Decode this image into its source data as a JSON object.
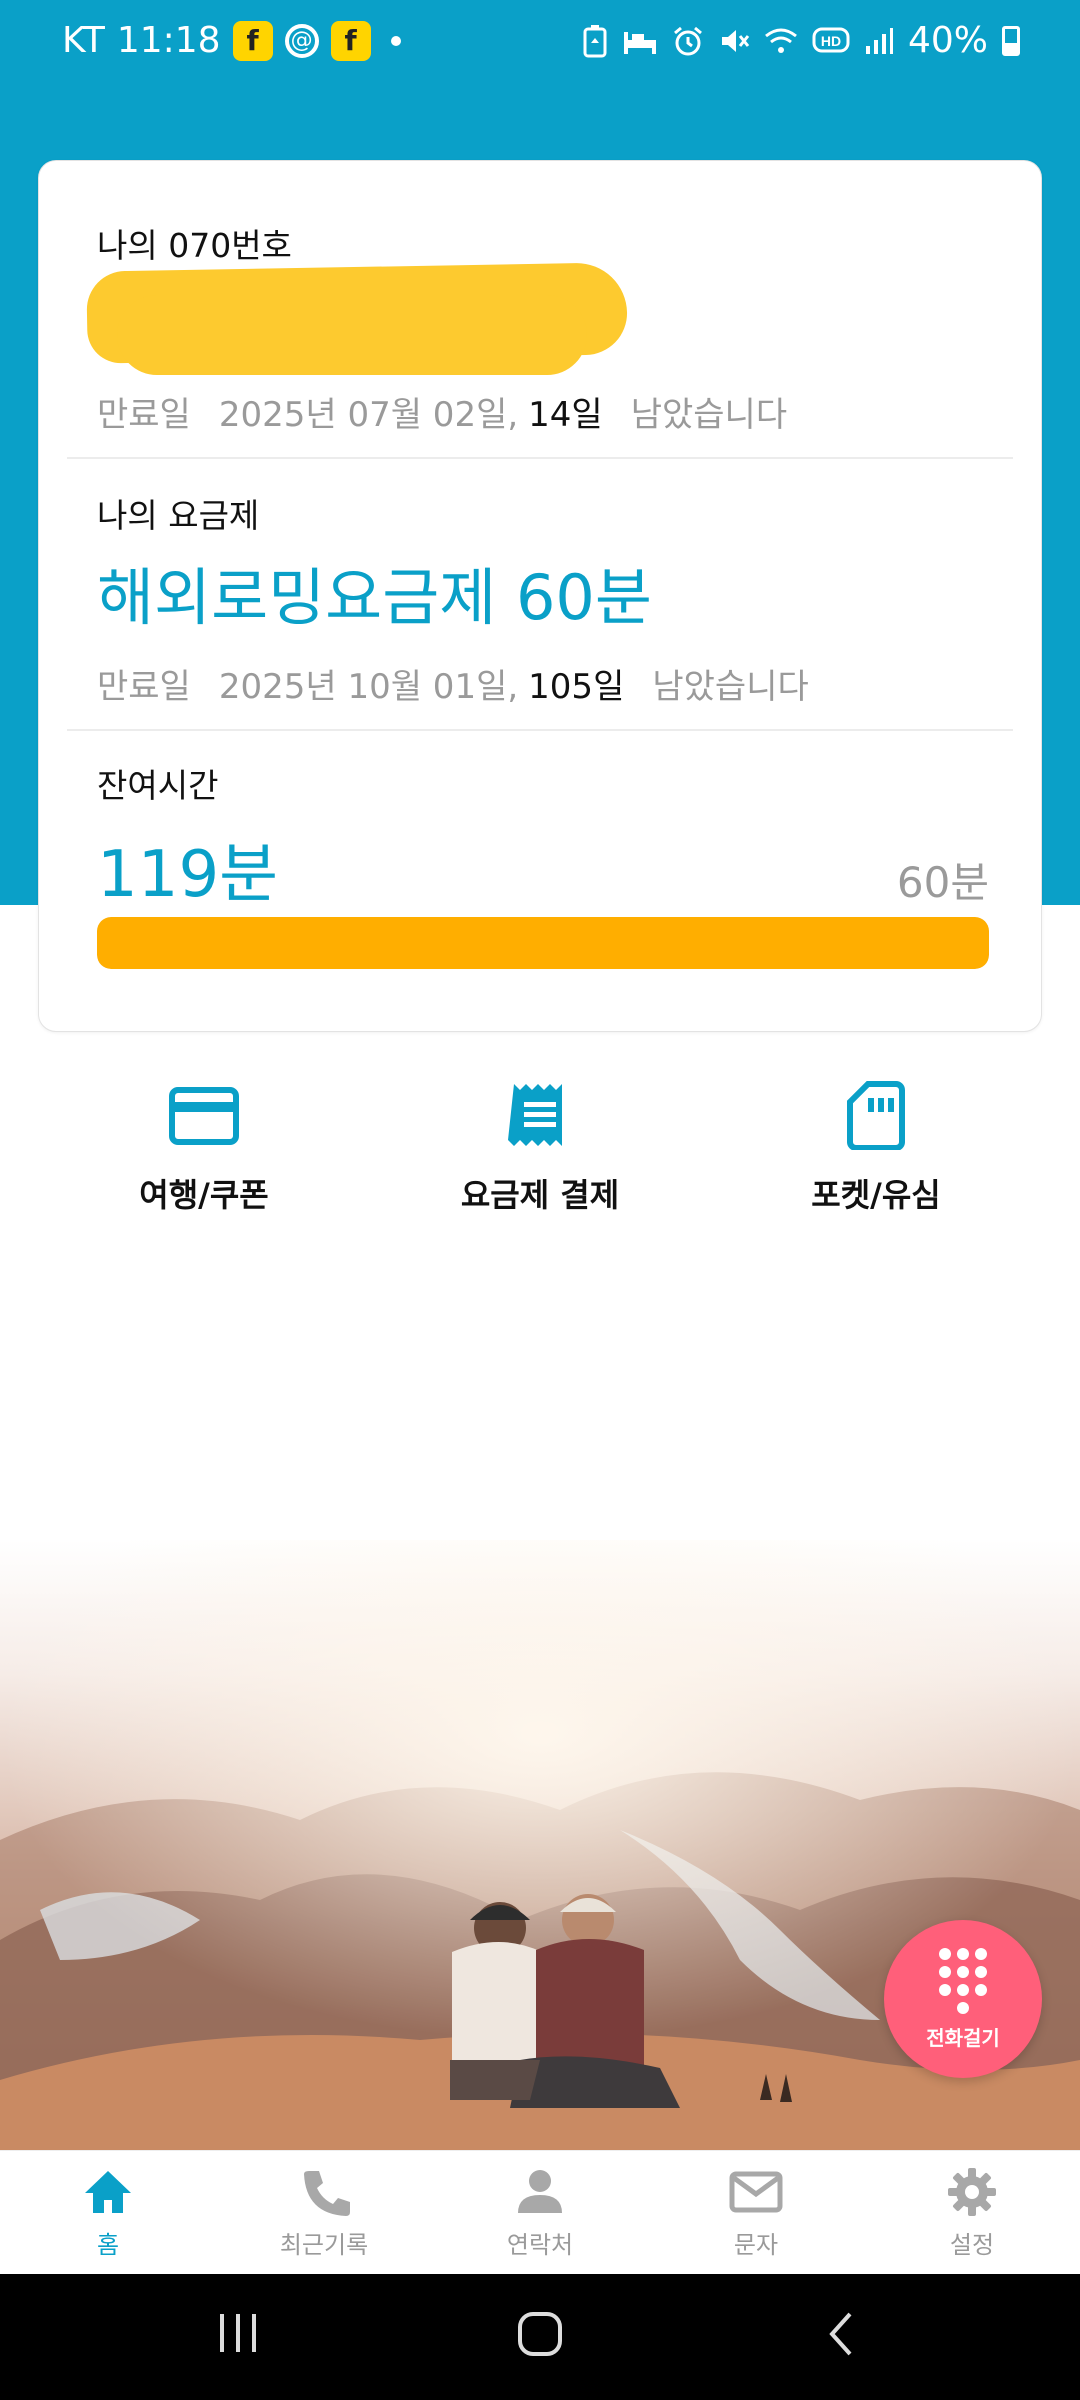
{
  "status_bar": {
    "carrier": "KT",
    "time": "11:18",
    "notif_badge_1": "f",
    "notif_threads": "@",
    "notif_badge_2": "f",
    "battery": "40%",
    "icons": [
      "battery-saver-icon",
      "sleep-icon",
      "alarm-icon",
      "mute-icon",
      "wifi-icon",
      "hd-icon",
      "signal-icon"
    ]
  },
  "card": {
    "number_section": {
      "label": "나의 070번호",
      "expire_label": "만료일",
      "expire_date": "2025년 07월 02일,",
      "days_left": "14일",
      "suffix": "남았습니다"
    },
    "plan_section": {
      "label": "나의 요금제",
      "plan_name": "해외로밍요금제 60분",
      "expire_label": "만료일",
      "expire_date": "2025년 10월 01일,",
      "days_left": "105일",
      "suffix": "남았습니다"
    },
    "remain_section": {
      "label": "잔여시간",
      "remaining": "119분",
      "plan_minutes": "60분",
      "progress_fraction": 1.0
    }
  },
  "quick_menu": [
    {
      "label": "여행/쿠폰",
      "icon": "card-icon"
    },
    {
      "label": "요금제 결제",
      "icon": "receipt-icon"
    },
    {
      "label": "포켓/유심",
      "icon": "sim-card-icon"
    }
  ],
  "fab": {
    "label": "전화걸기",
    "icon": "dialpad-icon"
  },
  "bottom_nav": [
    {
      "label": "홈",
      "icon": "home-icon",
      "active": true
    },
    {
      "label": "최근기록",
      "icon": "phone-icon",
      "active": false
    },
    {
      "label": "연락처",
      "icon": "person-icon",
      "active": false
    },
    {
      "label": "문자",
      "icon": "mail-icon",
      "active": false
    },
    {
      "label": "설정",
      "icon": "gear-icon",
      "active": false
    }
  ],
  "colors": {
    "accent": "#0aa0c8",
    "progress": "#ffae00",
    "fab": "#ff5f7a",
    "muted": "#9a9a9a"
  }
}
